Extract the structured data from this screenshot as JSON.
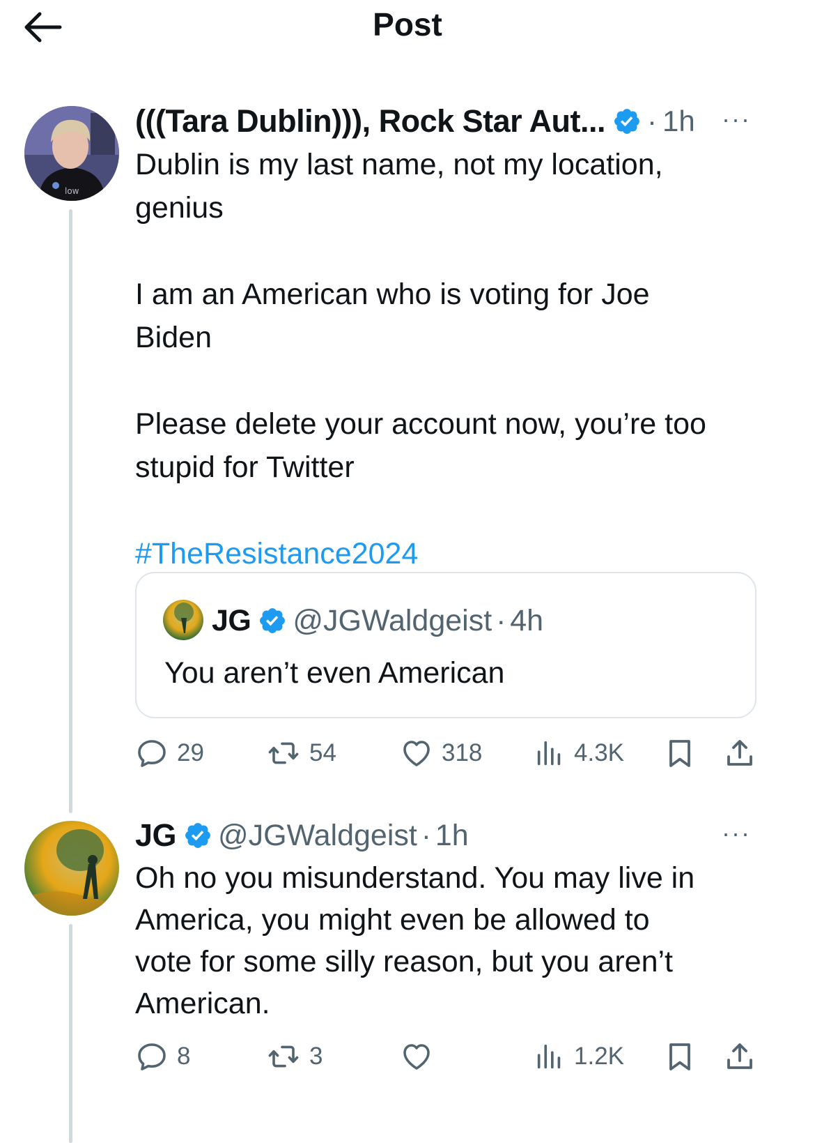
{
  "header": {
    "title": "Post",
    "back_icon": "arrow-left-icon"
  },
  "colors": {
    "link": "#1d9bf0",
    "verified": "#1d9bf0",
    "secondary_text": "#536471",
    "thread_line": "#cfd9de"
  },
  "main_post": {
    "display_name": "(((Tara Dublin))), Rock Star Aut...",
    "separator": "·",
    "time": "1h",
    "more": "···",
    "text": "Dublin is my last name, not my location,\ngenius\n\nI am an American who is voting for Joe\nBiden\n\nPlease delete your account now, you’re too\nstupid for Twitter\n\n",
    "hashtag": "#TheResistance2024",
    "quote": {
      "display_name": "JG",
      "handle": "@JGWaldgeist",
      "separator": "·",
      "time": "4h",
      "text": "You aren’t even American"
    },
    "stats": {
      "replies": "29",
      "reposts": "54",
      "likes": "318",
      "views": "4.3K"
    }
  },
  "reply_post": {
    "display_name": "JG",
    "handle": "@JGWaldgeist",
    "separator": "·",
    "time": "1h",
    "more": "···",
    "text": "Oh no you misunderstand. You may live in\nAmerica, you might even be allowed to\nvote for some silly reason, but you aren’t\nAmerican.",
    "stats": {
      "replies": "8",
      "reposts": "3",
      "likes": "",
      "views": "1.2K"
    }
  }
}
